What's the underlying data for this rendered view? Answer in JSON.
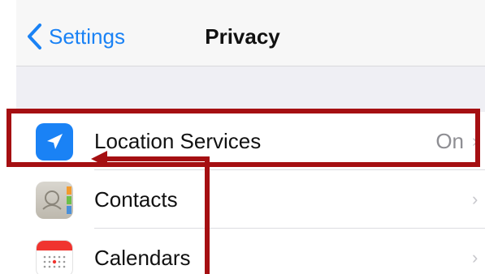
{
  "nav": {
    "back_label": "Settings",
    "title": "Privacy"
  },
  "rows": [
    {
      "label": "Location Services",
      "value": "On",
      "icon": "location-arrow-icon"
    },
    {
      "label": "Contacts",
      "value": "",
      "icon": "contacts-icon"
    },
    {
      "label": "Calendars",
      "value": "",
      "icon": "calendar-icon"
    }
  ],
  "colors": {
    "accent": "#1a82f5",
    "annotation": "#a50f12",
    "group_background": "#efeff4"
  }
}
